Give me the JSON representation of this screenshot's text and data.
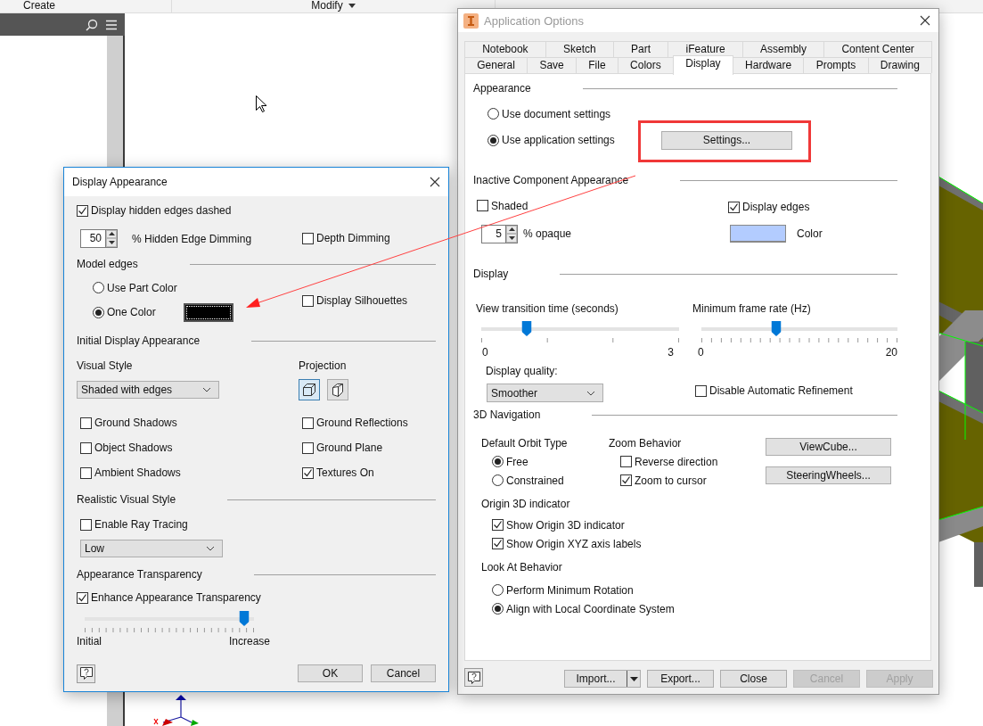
{
  "ribbon": {
    "tabs": [
      {
        "label": "Create",
        "menu": false
      },
      {
        "label": "Modify",
        "menu": true
      }
    ]
  },
  "display_appearance": {
    "title": "Display Appearance",
    "hidden_edges_dashed": {
      "label": "Display hidden edges dashed",
      "checked": true
    },
    "hidden_edge_dimming": {
      "value": "50",
      "label": "% Hidden Edge Dimming"
    },
    "depth_dimming": {
      "label": "Depth Dimming",
      "checked": false
    },
    "model_edges": {
      "heading": "Model edges",
      "options": [
        {
          "label": "Use Part Color",
          "selected": false
        },
        {
          "label": "One Color",
          "selected": true
        }
      ]
    },
    "display_silhouettes": {
      "label": "Display Silhouettes",
      "checked": false
    },
    "initial_display": {
      "heading": "Initial Display Appearance",
      "visual_style_label": "Visual Style",
      "visual_style": "Shaded with edges",
      "projection_label": "Projection",
      "projections": [
        {
          "kind": "orthographic",
          "selected": true
        },
        {
          "kind": "perspective",
          "selected": false
        }
      ],
      "options": [
        {
          "label": "Ground Shadows",
          "checked": false
        },
        {
          "label": "Ground Reflections",
          "checked": false
        },
        {
          "label": "Object Shadows",
          "checked": false
        },
        {
          "label": "Ground Plane",
          "checked": false
        },
        {
          "label": "Ambient Shadows",
          "checked": false
        },
        {
          "label": "Textures On",
          "checked": true
        }
      ]
    },
    "realistic": {
      "heading": "Realistic Visual Style",
      "ray_tracing": {
        "label": "Enable Ray Tracing",
        "checked": false
      },
      "quality": "Low"
    },
    "transparency": {
      "heading": "Appearance Transparency",
      "enhance": {
        "label": "Enhance Appearance Transparency",
        "checked": true
      },
      "level": 1,
      "min_label": "Initial",
      "max_label": "Increase"
    },
    "buttons": [
      "OK",
      "Cancel"
    ]
  },
  "application_options": {
    "title": "Application Options",
    "tab_rows": [
      {
        "tabs": [
          {
            "label": "Notebook",
            "selected": false
          },
          {
            "label": "Sketch",
            "selected": false
          },
          {
            "label": "Part",
            "selected": false
          },
          {
            "label": "iFeature",
            "selected": false
          },
          {
            "label": "Assembly",
            "selected": false
          },
          {
            "label": "Content Center",
            "selected": false
          }
        ]
      },
      {
        "tabs": [
          {
            "label": "General",
            "selected": false
          },
          {
            "label": "Save",
            "selected": false
          },
          {
            "label": "File",
            "selected": false
          },
          {
            "label": "Colors",
            "selected": false
          },
          {
            "label": "Display",
            "selected": true
          },
          {
            "label": "Hardware",
            "selected": false
          },
          {
            "label": "Prompts",
            "selected": false
          },
          {
            "label": "Drawing",
            "selected": false
          }
        ]
      }
    ],
    "appearance": {
      "heading": "Appearance",
      "options": [
        {
          "label": "Use document settings",
          "selected": false
        },
        {
          "label": "Use application settings",
          "selected": true
        }
      ],
      "settings_button": "Settings..."
    },
    "inactive": {
      "heading": "Inactive Component Appearance",
      "shaded": {
        "label": "Shaded",
        "checked": false
      },
      "opacity": {
        "value": "5",
        "label": "% opaque"
      },
      "display_edges": {
        "label": "Display edges",
        "checked": true
      },
      "color": "#b3ccff",
      "color_label": "Color"
    },
    "display": {
      "heading": "Display",
      "transition": {
        "label": "View transition time (seconds)",
        "level": 0.24,
        "min": "0",
        "max": "3"
      },
      "frame_rate": {
        "label": "Minimum frame rate (Hz)",
        "level": 0.4,
        "min": "0",
        "max": "20"
      },
      "quality_label": "Display quality:",
      "quality": "Smoother",
      "disable_refinement": {
        "label": "Disable Automatic Refinement",
        "checked": false
      }
    },
    "navigation": {
      "heading": "3D Navigation",
      "orbit": {
        "label": "Default Orbit Type",
        "options": [
          {
            "label": "Free",
            "selected": true
          },
          {
            "label": "Constrained",
            "selected": false
          }
        ]
      },
      "zoom": {
        "label": "Zoom Behavior",
        "options": [
          {
            "label": "Reverse direction",
            "checked": false
          },
          {
            "label": "Zoom to cursor",
            "checked": true
          }
        ]
      },
      "buttons": [
        "ViewCube...",
        "SteeringWheels..."
      ],
      "origin": {
        "label": "Origin 3D indicator",
        "options": [
          {
            "label": "Show Origin 3D indicator",
            "checked": true
          },
          {
            "label": "Show Origin XYZ axis labels",
            "checked": true
          }
        ]
      },
      "look_at": {
        "label": "Look At Behavior",
        "options": [
          {
            "label": "Perform Minimum Rotation",
            "selected": false
          },
          {
            "label": "Align with Local Coordinate System",
            "selected": true
          }
        ]
      }
    },
    "buttons": [
      {
        "label": "Import...",
        "kind": "split",
        "disabled": false
      },
      {
        "label": "Export...",
        "kind": "plain",
        "disabled": false
      },
      {
        "label": "Close",
        "kind": "plain",
        "disabled": false
      },
      {
        "label": "Cancel",
        "kind": "plain",
        "disabled": true
      },
      {
        "label": "Apply",
        "kind": "plain",
        "disabled": true
      }
    ]
  }
}
